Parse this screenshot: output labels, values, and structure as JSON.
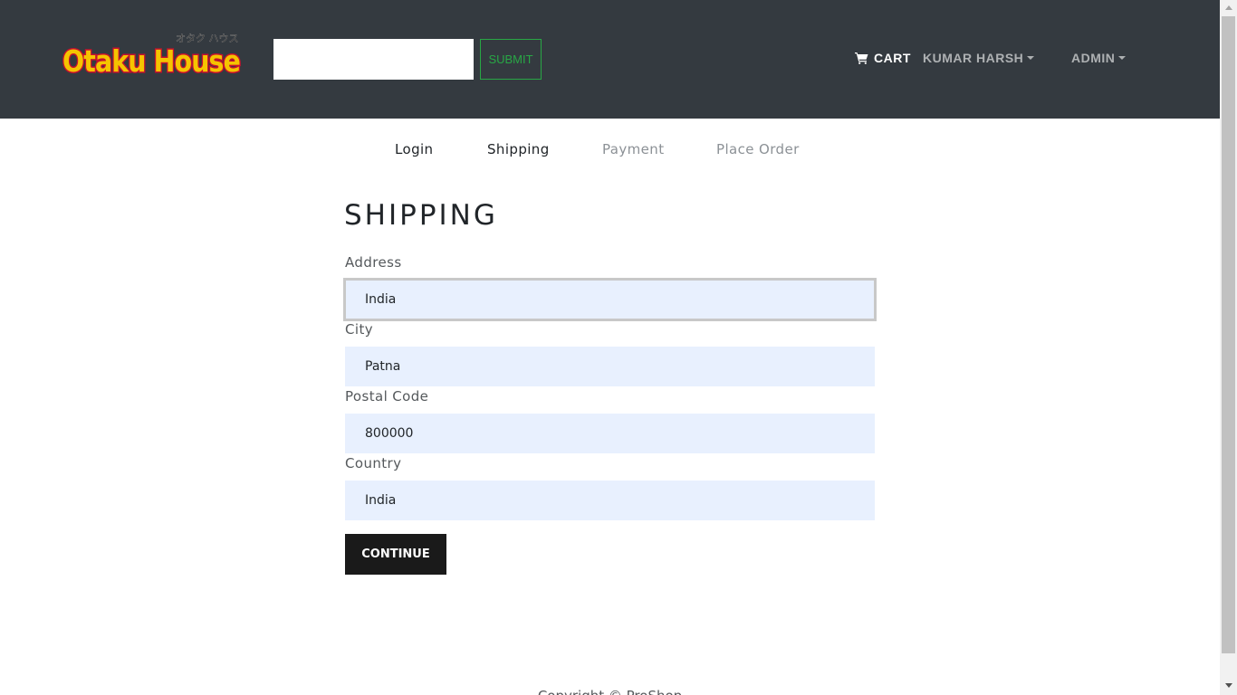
{
  "header": {
    "logo_text": "Otaku House",
    "search": {
      "value": "",
      "placeholder": ""
    },
    "submit_label": "Submit",
    "cart_label": "Cart",
    "user_label": "Kumar Harsh",
    "admin_label": "Admin"
  },
  "steps": [
    {
      "label": "Login",
      "state": "active"
    },
    {
      "label": "Shipping",
      "state": "active"
    },
    {
      "label": "Payment",
      "state": "disabled"
    },
    {
      "label": "Place Order",
      "state": "disabled"
    }
  ],
  "form": {
    "title": "Shipping",
    "address": {
      "label": "Address",
      "value": "India"
    },
    "city": {
      "label": "City",
      "value": "Patna"
    },
    "postal_code": {
      "label": "Postal Code",
      "value": "800000"
    },
    "country": {
      "label": "Country",
      "value": "India"
    },
    "continue_label": "Continue"
  },
  "footer": {
    "copyright": "Copyright © ProShop"
  },
  "colors": {
    "navbar": "#343a40",
    "submit_accent": "#28a745",
    "field_background": "#e8f0fe",
    "button_dark": "#1a1a1a"
  }
}
